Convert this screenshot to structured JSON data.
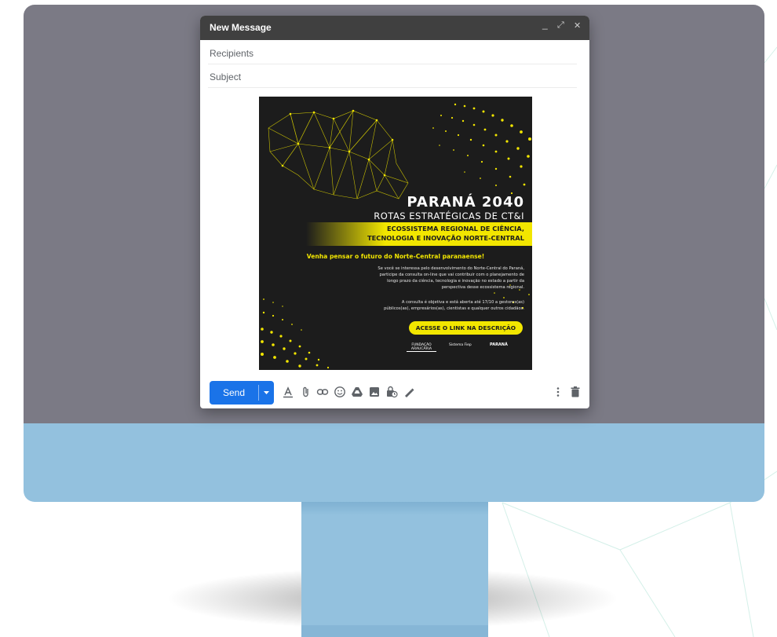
{
  "compose": {
    "title": "New Message",
    "controls": {
      "minimize": "_",
      "expand": "⤢",
      "close": "✕"
    },
    "recipients_placeholder": "Recipients",
    "subject_placeholder": "Subject"
  },
  "poster": {
    "title": "PARANÁ 2040",
    "subtitle": "ROTAS ESTRATÉGICAS DE CT&I",
    "band_line1": "ECOSSISTEMA REGIONAL DE CIÊNCIA,",
    "band_line2": "TECNOLOGIA E INOVAÇÃO NORTE-CENTRAL",
    "tagline": "Venha pensar o futuro do Norte-Central paranaense!",
    "body1_line1": "Se você se interessa pelo desenvolvimento do Norte-Central do Paraná,",
    "body1_line2": "participe da consulta on-line que vai contribuir com o planejamento de",
    "body1_line3": "longo prazo da ciência, tecnologia e inovação no estado a partir da",
    "body1_line4": "perspectiva desse ecossistema regional.",
    "body2_line1": "A consulta é objetiva e está aberta até 17/10 a gestores(as)",
    "body2_line2": "públicos(as), empresários(as), cientistas e qualquer outros cidadãos.",
    "cta": "ACESSE O LINK NA DESCRIÇÃO",
    "logo1": "FUNDAÇÃO ARAUCÁRIA",
    "logo2": "Sistema Fiep",
    "logo3": "PARANÁ"
  },
  "toolbar": {
    "send_label": "Send",
    "icons": [
      "format-text-icon",
      "attach-icon",
      "link-icon",
      "emoji-icon",
      "drive-icon",
      "photo-icon",
      "lock-clock-icon",
      "signature-icon",
      "more-options-icon",
      "trash-icon"
    ]
  },
  "colors": {
    "screen": "#7b7a85",
    "chin": "#93c1de",
    "send": "#1a73e8",
    "poster_bg": "#1c1c1c",
    "poster_accent": "#f2e600"
  }
}
